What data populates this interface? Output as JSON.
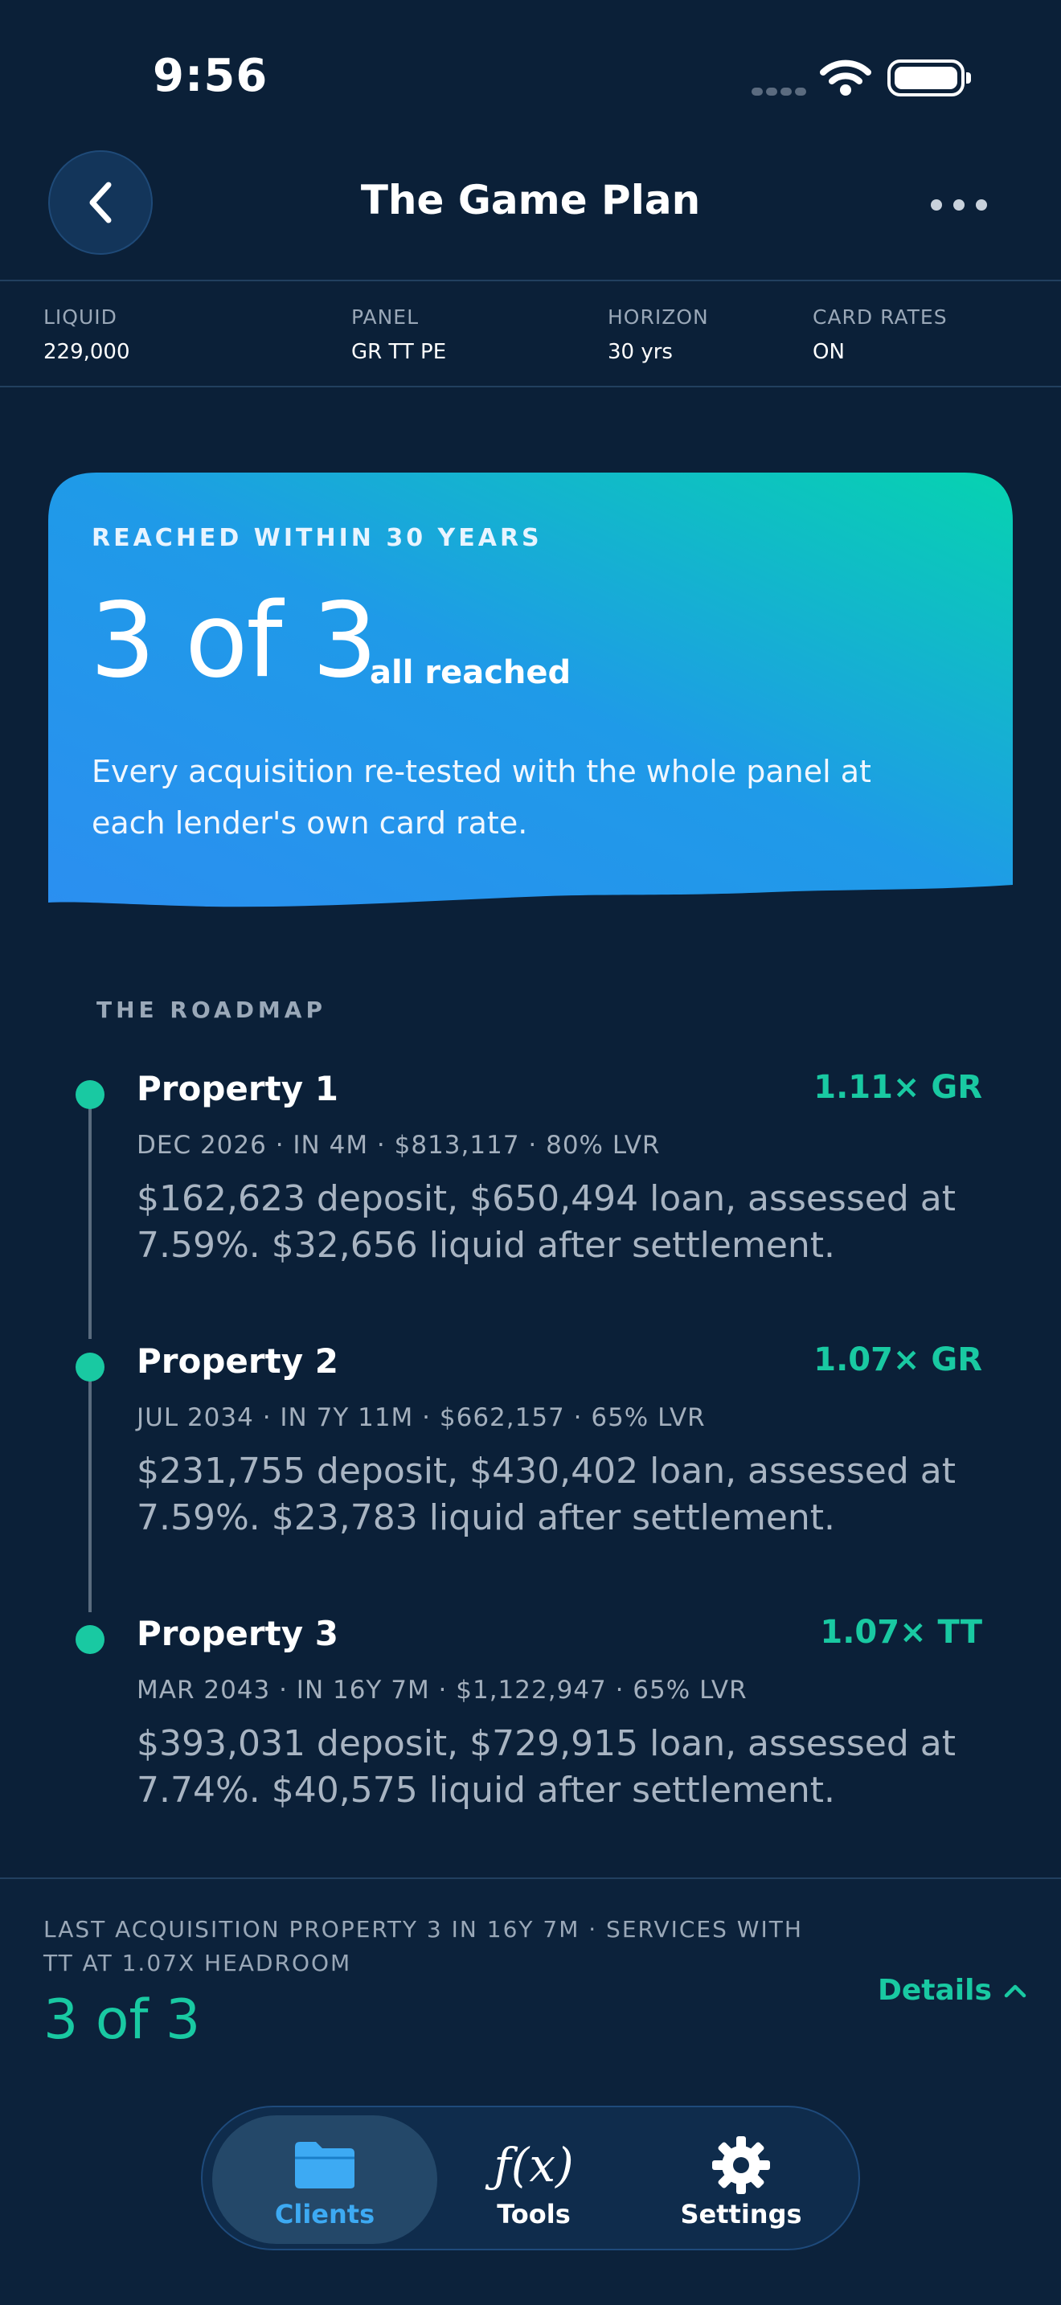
{
  "status_bar": {
    "time": "9:56"
  },
  "nav": {
    "title": "The Game Plan"
  },
  "summary": [
    {
      "label": "LIQUID",
      "value": "229,000"
    },
    {
      "label": "PANEL",
      "value": "GR TT PE"
    },
    {
      "label": "HORIZON",
      "value": "30 yrs"
    },
    {
      "label": "CARD RATES",
      "value": "ON"
    }
  ],
  "hero": {
    "eyebrow": "REACHED WITHIN 30 YEARS",
    "count": "3 of 3",
    "sub": "all reached",
    "description": "Every acquisition re-tested with the whole panel at each lender's own card rate.",
    "gradient_start": "#2b8ff0",
    "gradient_end": "#06d3b0"
  },
  "roadmap": {
    "label": "THE ROADMAP",
    "items": [
      {
        "title": "Property 1",
        "ratio": "1.11× GR",
        "meta": "DEC 2026 · IN 4M · $813,117 · 80% LVR",
        "description": "$162,623 deposit, $650,494 loan, assessed at 7.59%. $32,656 liquid after settlement."
      },
      {
        "title": "Property 2",
        "ratio": "1.07× GR",
        "meta": "JUL 2034 · IN 7Y 11M · $662,157 · 65% LVR",
        "description": "$231,755 deposit, $430,402 loan, assessed at 7.59%. $23,783 liquid after settlement."
      },
      {
        "title": "Property 3",
        "ratio": "1.07× TT",
        "meta": "MAR 2043 · IN 16Y 7M · $1,122,947 · 65% LVR",
        "description": "$393,031 deposit, $729,915 loan, assessed at 7.74%. $40,575 liquid after settlement."
      }
    ]
  },
  "footer": {
    "note": "LAST ACQUISITION PROPERTY 3 IN 16Y 7M · SERVICES WITH TT AT 1.07X HEADROOM",
    "count": "3 of 3",
    "details_label": "Details"
  },
  "tabbar": {
    "tabs": [
      {
        "label": "Clients",
        "icon": "folder-icon",
        "active": true
      },
      {
        "label": "Tools",
        "icon": "fx-icon",
        "active": false
      },
      {
        "label": "Settings",
        "icon": "gear-icon",
        "active": false
      }
    ],
    "fx_glyph": "ƒ(x)"
  },
  "colors": {
    "accent": "#19c9a2",
    "background": "#0b2038",
    "tab_active": "#3daaf3"
  }
}
